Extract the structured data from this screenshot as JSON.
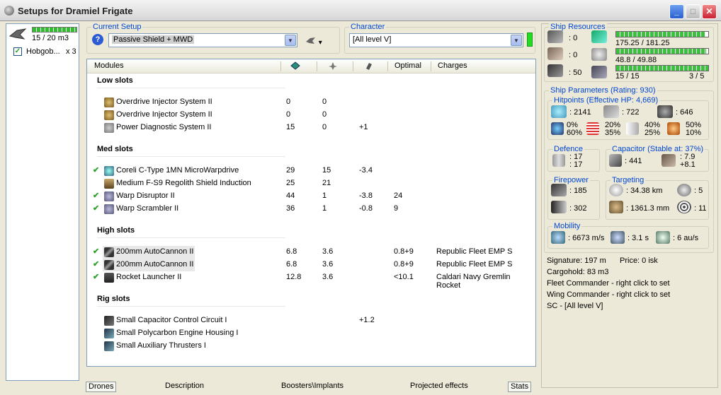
{
  "window": {
    "title": "Setups for Dramiel Frigate"
  },
  "fleet": {
    "cargo": "15 / 20 m3",
    "item_label": "Hobgob...",
    "item_qty": "x 3"
  },
  "setup": {
    "group_label": "Current Setup",
    "value": "Passive Shield + MWD"
  },
  "character": {
    "group_label": "Character",
    "value": "[All level V]"
  },
  "columns": {
    "modules": "Modules",
    "optimal": "Optimal",
    "charges": "Charges"
  },
  "sections": {
    "low": "Low slots",
    "med": "Med slots",
    "high": "High slots",
    "rig": "Rig slots"
  },
  "low": [
    {
      "name": "Overdrive Injector System II",
      "c1": "0",
      "c2": "0",
      "c3": "",
      "opt": "",
      "chg": ""
    },
    {
      "name": "Overdrive Injector System II",
      "c1": "0",
      "c2": "0",
      "c3": "",
      "opt": "",
      "chg": ""
    },
    {
      "name": "Power Diagnostic System II",
      "c1": "15",
      "c2": "0",
      "c3": "+1",
      "opt": "",
      "chg": ""
    }
  ],
  "med": [
    {
      "name": "Coreli C-Type 1MN MicroWarpdrive",
      "c1": "29",
      "c2": "15",
      "c3": "-3.4",
      "opt": "",
      "chg": ""
    },
    {
      "name": "Medium F-S9 Regolith Shield Induction",
      "c1": "25",
      "c2": "21",
      "c3": "",
      "opt": "",
      "chg": ""
    },
    {
      "name": "Warp Disruptor II",
      "c1": "44",
      "c2": "1",
      "c3": "-3.8",
      "opt": "24",
      "chg": ""
    },
    {
      "name": "Warp Scrambler II",
      "c1": "36",
      "c2": "1",
      "c3": "-0.8",
      "opt": "9",
      "chg": ""
    }
  ],
  "high": [
    {
      "name": "200mm AutoCannon II",
      "c1": "6.8",
      "c2": "3.6",
      "c3": "",
      "opt": "0.8+9",
      "chg": "Republic Fleet EMP S"
    },
    {
      "name": "200mm AutoCannon II",
      "c1": "6.8",
      "c2": "3.6",
      "c3": "",
      "opt": "0.8+9",
      "chg": "Republic Fleet EMP S"
    },
    {
      "name": "Rocket Launcher II",
      "c1": "12.8",
      "c2": "3.6",
      "c3": "",
      "opt": "<10.1",
      "chg": "Caldari Navy Gremlin Rocket"
    }
  ],
  "rig": [
    {
      "name": "Small Capacitor Control Circuit I",
      "c1": "",
      "c2": "",
      "c3": "+1.2",
      "opt": "",
      "chg": ""
    },
    {
      "name": "Small Polycarbon Engine Housing I",
      "c1": "",
      "c2": "",
      "c3": "",
      "opt": "",
      "chg": ""
    },
    {
      "name": "Small Auxiliary Thrusters I",
      "c1": "",
      "c2": "",
      "c3": "",
      "opt": "",
      "chg": ""
    }
  ],
  "tabs": {
    "drones": "Drones",
    "description": "Description",
    "boosters": "Boosters\\Implants",
    "projected": "Projected effects",
    "stats": "Stats"
  },
  "resources": {
    "label": "Ship Resources",
    "turret": ": 0",
    "launcher": ": 0",
    "calib": ": 50",
    "cpu": "175.25 / 181.25",
    "power": "48.8 / 49.88",
    "drone_bw": "15 / 15",
    "drone_count": "3 / 5",
    "cpu_fill": 0.967,
    "power_fill": 0.978,
    "bw_fill": 1.0
  },
  "params": {
    "label": "Ship Parameters (Rating: 930)",
    "hp_label": "Hitpoints (Effective HP: 4,669)",
    "shield_hp": ": 2141",
    "armor_hp": ": 722",
    "hull_hp": ": 646",
    "res1a": "0%",
    "res1b": "60%",
    "res2a": "20%",
    "res2b": "35%",
    "res3a": "40%",
    "res3b": "25%",
    "res4a": "50%",
    "res4b": "10%",
    "defence_label": "Defence",
    "def1": ": 17",
    "def2": ": 17",
    "cap_label": "Capacitor (Stable at: 37%)",
    "cap": ": 441",
    "cap1": ": 7.9",
    "cap2": "+8.1",
    "fire_label": "Firepower",
    "fire1": ": 185",
    "fire2": ": 302",
    "targ_label": "Targeting",
    "targ_range": ": 34.38 km",
    "targ_max": ": 5",
    "scan_res": ": 1361.3 mm",
    "sensor": ": 11",
    "mob_label": "Mobility",
    "speed": ": 6673 m/s",
    "align": ": 3.1 s",
    "warp": ": 6 au/s"
  },
  "misc": {
    "signature": "Signature: 197 m",
    "price": "Price: 0 isk",
    "cargohold": "Cargohold: 83 m3",
    "fleet_cmd": "Fleet Commander - right click to set",
    "wing_cmd": "Wing Commander - right click to set",
    "sc": "SC - [All level V]"
  }
}
